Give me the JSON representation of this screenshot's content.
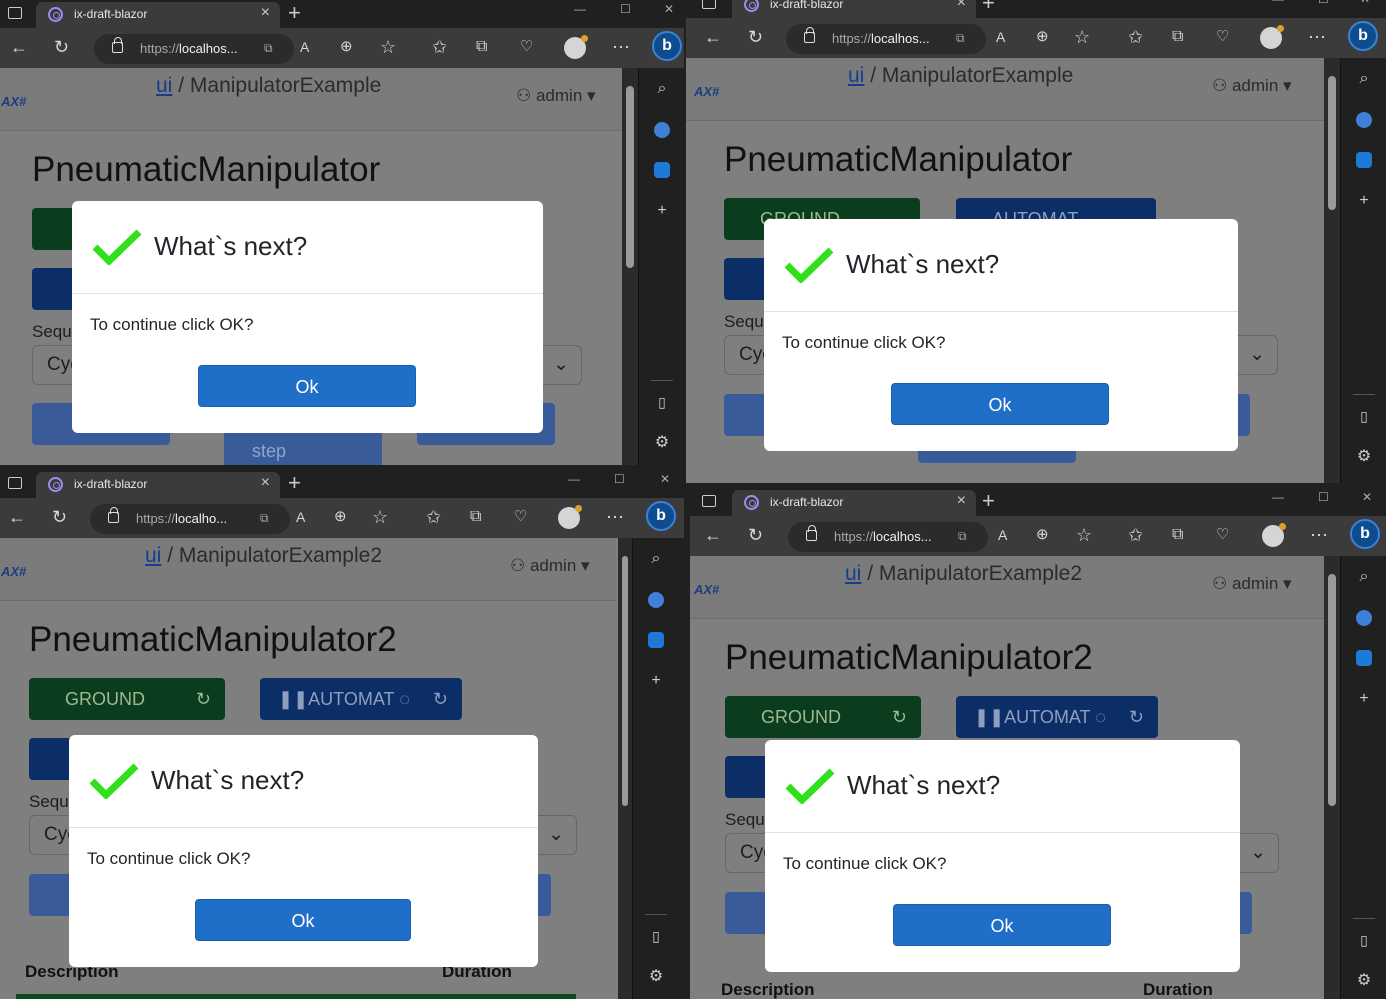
{
  "browser": {
    "tab_title": "ix-draft-blazor",
    "url_scheme": "https://",
    "url_host_long": "localhos...",
    "url_host_short": "localho...",
    "new_tab": "+",
    "tab_close": "×",
    "minimize": "—",
    "maximize": "☐",
    "close": "✕"
  },
  "app": {
    "brand": "AX#",
    "crumb_root": "ui",
    "crumb_sep": "/",
    "user": "admin"
  },
  "windows": [
    {
      "page": "ManipulatorExample",
      "heading": "PneumaticManipulator"
    },
    {
      "page": "ManipulatorExample",
      "heading": "PneumaticManipulator"
    },
    {
      "page": "ManipulatorExample2",
      "heading": "PneumaticManipulator2"
    },
    {
      "page": "ManipulatorExample2",
      "heading": "PneumaticManipulator2"
    }
  ],
  "controls": {
    "ground": "GROUND",
    "automat": "AUTOMAT",
    "step": "step",
    "sequence_label": "Sequ",
    "cycle_select": "Cyc",
    "ground_partial": "GROUND",
    "automat_partial": "AUTOMAT"
  },
  "dialog": {
    "title": "What`s next?",
    "message": "To continue click OK?",
    "ok": "Ok"
  },
  "table": {
    "col_description": "Description",
    "col_duration": "Duration"
  }
}
